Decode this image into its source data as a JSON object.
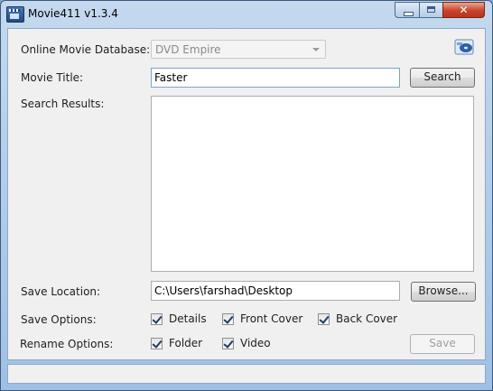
{
  "window": {
    "title": "Movie411 v1.3.4",
    "close_glyph": "✕"
  },
  "form": {
    "database_label": "Online Movie Database:",
    "database_value": "DVD Empire",
    "title_label": "Movie Title:",
    "title_value": "Faster",
    "search_button": "Search",
    "results_label": "Search Results:",
    "location_label": "Save Location:",
    "location_value": "C:\\Users\\farshad\\Desktop",
    "browse_button": "Browse...",
    "save_options_label": "Save Options:",
    "save_options": [
      {
        "label": "Details",
        "checked": true
      },
      {
        "label": "Front Cover",
        "checked": true
      },
      {
        "label": "Back Cover",
        "checked": true
      }
    ],
    "rename_options_label": "Rename Options:",
    "rename_options": [
      {
        "label": "Folder",
        "checked": true
      },
      {
        "label": "Video",
        "checked": true
      }
    ],
    "save_button": "Save"
  },
  "icons": {
    "app": "clapperboard-icon",
    "database": "disc-drive-icon"
  }
}
